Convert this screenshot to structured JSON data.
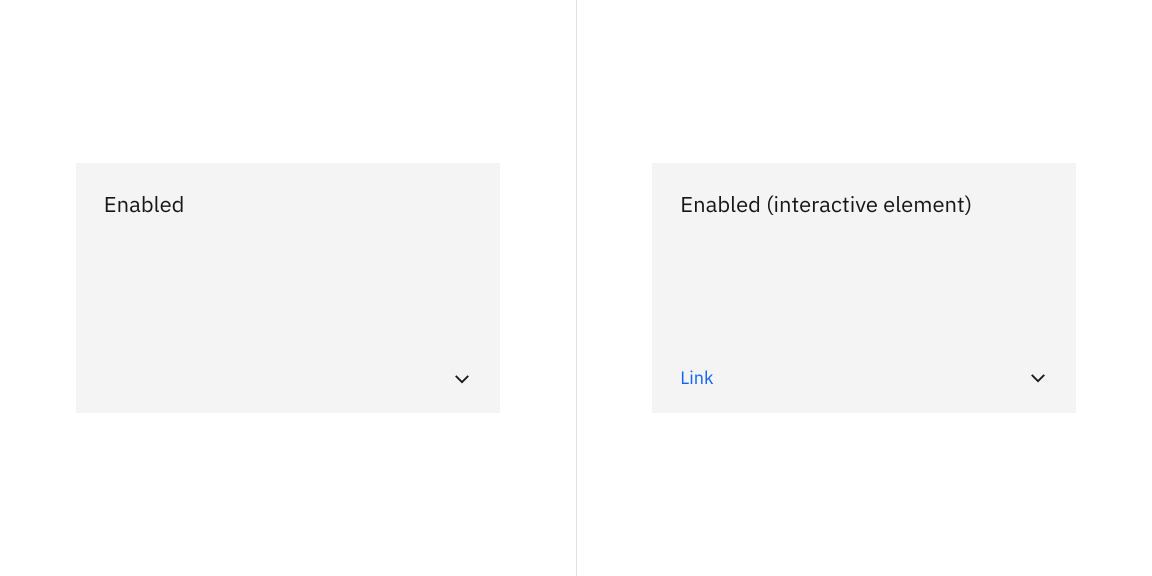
{
  "left": {
    "title": "Enabled"
  },
  "right": {
    "title": "Enabled (interactive element)",
    "link_label": "Link"
  }
}
